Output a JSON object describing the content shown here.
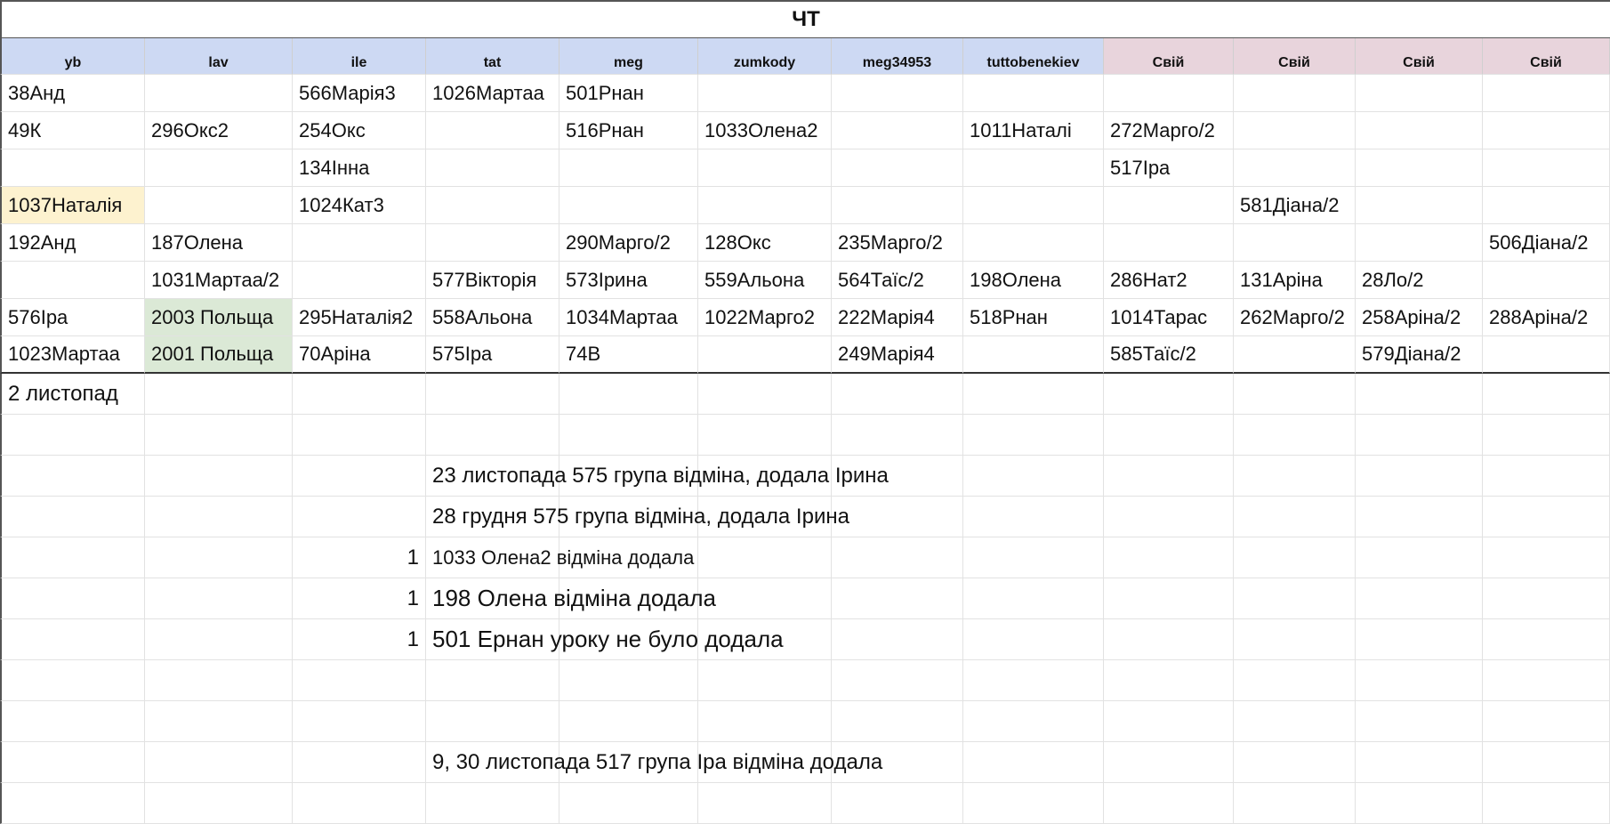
{
  "sheet": {
    "title": "ЧТ",
    "headers": [
      "yb",
      "lav",
      "ile",
      "tat",
      "meg",
      "zumkody",
      "meg34953",
      "tuttobenekiev",
      "Свій",
      "Свій",
      "Свій",
      "Свій"
    ],
    "header_colors": {
      "blue": "#cdd9f3",
      "pink": "#e8d4dc"
    },
    "rows": [
      [
        "38Анд",
        "",
        "566Марія3",
        "1026Мартаа",
        "501Рнан",
        "",
        "",
        "",
        "",
        "",
        "",
        ""
      ],
      [
        "49К",
        "296Окс2",
        "254Окс",
        "",
        "516Рнан",
        "1033Олена2",
        "",
        "1011Наталі",
        "272Марго/2",
        "",
        "",
        ""
      ],
      [
        "",
        "",
        "134Інна",
        "",
        "",
        "",
        "",
        "",
        "517Іра",
        "",
        "",
        ""
      ],
      [
        "1037Наталія",
        "",
        "1024Кат3",
        "",
        "",
        "",
        "",
        "",
        "",
        "581Діана/2",
        "",
        ""
      ],
      [
        "192Анд",
        "187Олена",
        "",
        "",
        "290Марго/2",
        "128Окс",
        "235Марго/2",
        "",
        "",
        "",
        "",
        "506Діана/2"
      ],
      [
        "",
        "1031Мартаа/2",
        "",
        "577Вікторія",
        "573Ірина",
        "559Альона",
        "564Таїс/2",
        "198Олена",
        "286Нат2",
        "131Аріна",
        "28Ло/2",
        ""
      ],
      [
        "576Іра",
        "2003 Польща",
        "295Наталія2",
        "558Альона",
        "1034Мартаа",
        "1022Марго2",
        "222Марія4",
        "518Рнан",
        "1014Тарас",
        "262Марго/2",
        "258Аріна/2",
        "288Аріна/2"
      ],
      [
        "1023Мартаа",
        "2001 Польща",
        "70Аріна",
        "575Іра",
        "74В",
        "",
        "249Марія4",
        "",
        "585Таїс/2",
        "",
        "579Діана/2",
        ""
      ]
    ],
    "highlight_colors": {
      "yellow": "#fdf2cf",
      "green": "#dbe9d6"
    }
  },
  "notes": {
    "date_label": "2 листопад",
    "note1": "23 листопада 575 група відміна, додала Ірина",
    "note2": "28 грудня 575 група відміна, додала Ірина",
    "count1": "1",
    "note3": "1033 Олена2 відміна додала",
    "count2": "1",
    "note4": "198 Олена відміна додала",
    "count3": "1",
    "note5": "501 Ернан уроку не було додала",
    "note6": "9, 30 листопада 517 група Іра відміна додала"
  }
}
